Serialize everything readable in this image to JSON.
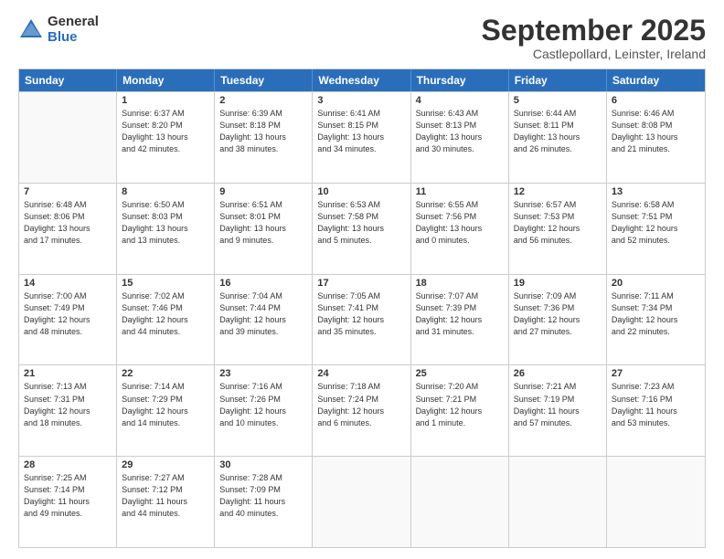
{
  "logo": {
    "general": "General",
    "blue": "Blue"
  },
  "title": "September 2025",
  "subtitle": "Castlepollard, Leinster, Ireland",
  "header_days": [
    "Sunday",
    "Monday",
    "Tuesday",
    "Wednesday",
    "Thursday",
    "Friday",
    "Saturday"
  ],
  "weeks": [
    [
      {
        "day": "",
        "text": ""
      },
      {
        "day": "1",
        "text": "Sunrise: 6:37 AM\nSunset: 8:20 PM\nDaylight: 13 hours\nand 42 minutes."
      },
      {
        "day": "2",
        "text": "Sunrise: 6:39 AM\nSunset: 8:18 PM\nDaylight: 13 hours\nand 38 minutes."
      },
      {
        "day": "3",
        "text": "Sunrise: 6:41 AM\nSunset: 8:15 PM\nDaylight: 13 hours\nand 34 minutes."
      },
      {
        "day": "4",
        "text": "Sunrise: 6:43 AM\nSunset: 8:13 PM\nDaylight: 13 hours\nand 30 minutes."
      },
      {
        "day": "5",
        "text": "Sunrise: 6:44 AM\nSunset: 8:11 PM\nDaylight: 13 hours\nand 26 minutes."
      },
      {
        "day": "6",
        "text": "Sunrise: 6:46 AM\nSunset: 8:08 PM\nDaylight: 13 hours\nand 21 minutes."
      }
    ],
    [
      {
        "day": "7",
        "text": "Sunrise: 6:48 AM\nSunset: 8:06 PM\nDaylight: 13 hours\nand 17 minutes."
      },
      {
        "day": "8",
        "text": "Sunrise: 6:50 AM\nSunset: 8:03 PM\nDaylight: 13 hours\nand 13 minutes."
      },
      {
        "day": "9",
        "text": "Sunrise: 6:51 AM\nSunset: 8:01 PM\nDaylight: 13 hours\nand 9 minutes."
      },
      {
        "day": "10",
        "text": "Sunrise: 6:53 AM\nSunset: 7:58 PM\nDaylight: 13 hours\nand 5 minutes."
      },
      {
        "day": "11",
        "text": "Sunrise: 6:55 AM\nSunset: 7:56 PM\nDaylight: 13 hours\nand 0 minutes."
      },
      {
        "day": "12",
        "text": "Sunrise: 6:57 AM\nSunset: 7:53 PM\nDaylight: 12 hours\nand 56 minutes."
      },
      {
        "day": "13",
        "text": "Sunrise: 6:58 AM\nSunset: 7:51 PM\nDaylight: 12 hours\nand 52 minutes."
      }
    ],
    [
      {
        "day": "14",
        "text": "Sunrise: 7:00 AM\nSunset: 7:49 PM\nDaylight: 12 hours\nand 48 minutes."
      },
      {
        "day": "15",
        "text": "Sunrise: 7:02 AM\nSunset: 7:46 PM\nDaylight: 12 hours\nand 44 minutes."
      },
      {
        "day": "16",
        "text": "Sunrise: 7:04 AM\nSunset: 7:44 PM\nDaylight: 12 hours\nand 39 minutes."
      },
      {
        "day": "17",
        "text": "Sunrise: 7:05 AM\nSunset: 7:41 PM\nDaylight: 12 hours\nand 35 minutes."
      },
      {
        "day": "18",
        "text": "Sunrise: 7:07 AM\nSunset: 7:39 PM\nDaylight: 12 hours\nand 31 minutes."
      },
      {
        "day": "19",
        "text": "Sunrise: 7:09 AM\nSunset: 7:36 PM\nDaylight: 12 hours\nand 27 minutes."
      },
      {
        "day": "20",
        "text": "Sunrise: 7:11 AM\nSunset: 7:34 PM\nDaylight: 12 hours\nand 22 minutes."
      }
    ],
    [
      {
        "day": "21",
        "text": "Sunrise: 7:13 AM\nSunset: 7:31 PM\nDaylight: 12 hours\nand 18 minutes."
      },
      {
        "day": "22",
        "text": "Sunrise: 7:14 AM\nSunset: 7:29 PM\nDaylight: 12 hours\nand 14 minutes."
      },
      {
        "day": "23",
        "text": "Sunrise: 7:16 AM\nSunset: 7:26 PM\nDaylight: 12 hours\nand 10 minutes."
      },
      {
        "day": "24",
        "text": "Sunrise: 7:18 AM\nSunset: 7:24 PM\nDaylight: 12 hours\nand 6 minutes."
      },
      {
        "day": "25",
        "text": "Sunrise: 7:20 AM\nSunset: 7:21 PM\nDaylight: 12 hours\nand 1 minute."
      },
      {
        "day": "26",
        "text": "Sunrise: 7:21 AM\nSunset: 7:19 PM\nDaylight: 11 hours\nand 57 minutes."
      },
      {
        "day": "27",
        "text": "Sunrise: 7:23 AM\nSunset: 7:16 PM\nDaylight: 11 hours\nand 53 minutes."
      }
    ],
    [
      {
        "day": "28",
        "text": "Sunrise: 7:25 AM\nSunset: 7:14 PM\nDaylight: 11 hours\nand 49 minutes."
      },
      {
        "day": "29",
        "text": "Sunrise: 7:27 AM\nSunset: 7:12 PM\nDaylight: 11 hours\nand 44 minutes."
      },
      {
        "day": "30",
        "text": "Sunrise: 7:28 AM\nSunset: 7:09 PM\nDaylight: 11 hours\nand 40 minutes."
      },
      {
        "day": "",
        "text": ""
      },
      {
        "day": "",
        "text": ""
      },
      {
        "day": "",
        "text": ""
      },
      {
        "day": "",
        "text": ""
      }
    ]
  ]
}
